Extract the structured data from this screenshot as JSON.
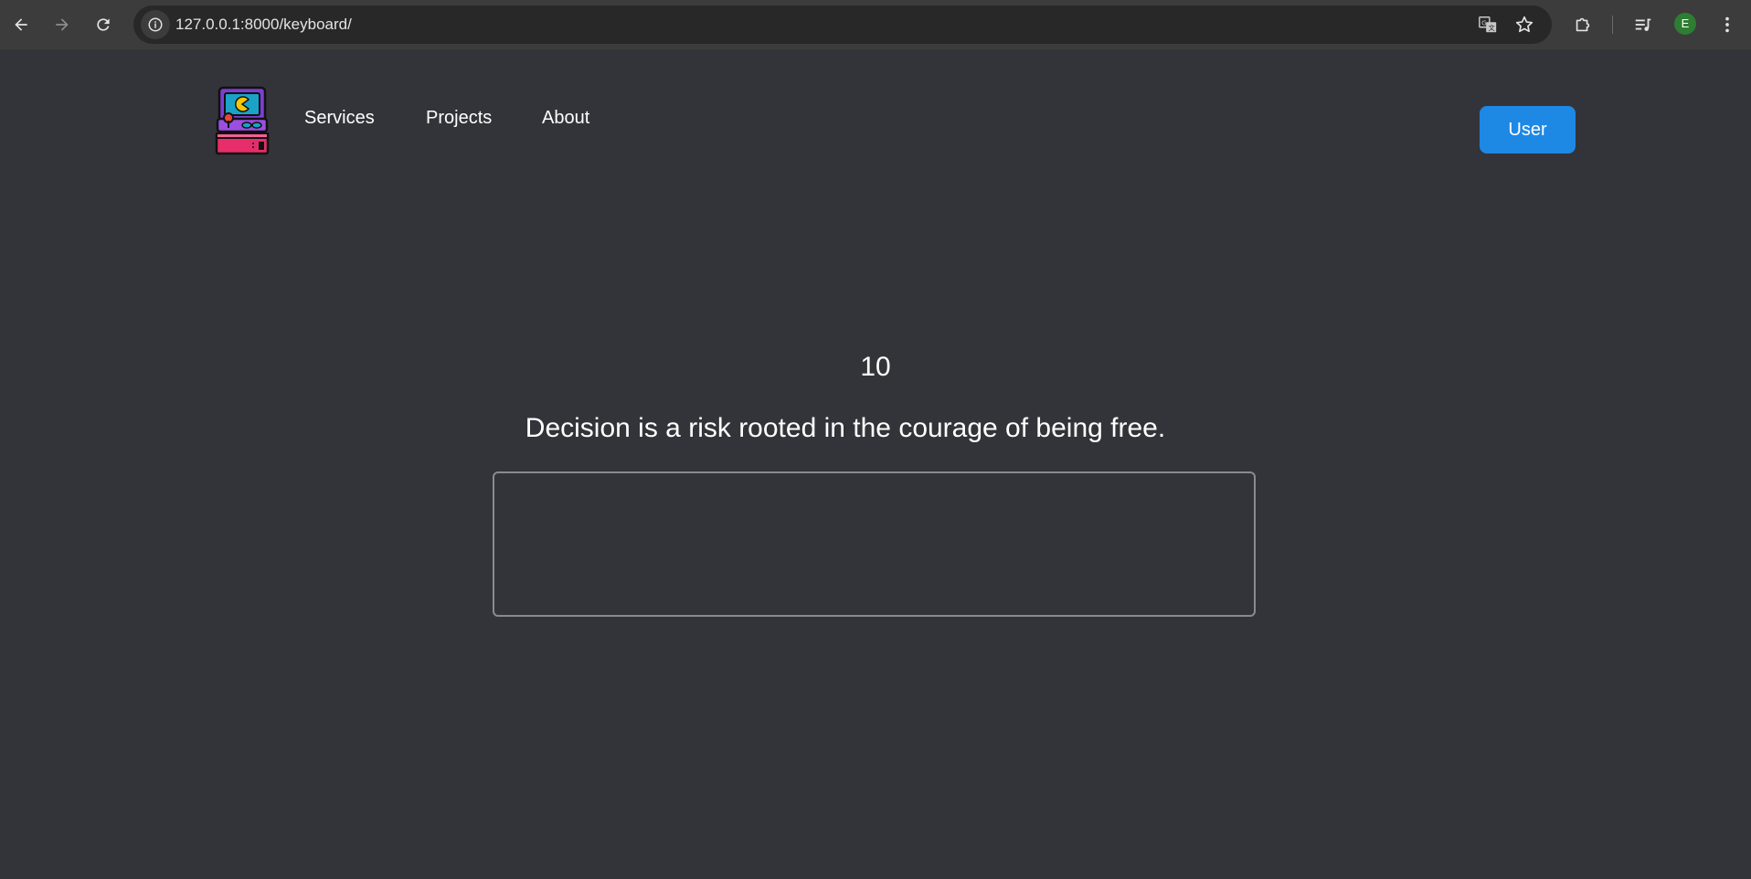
{
  "browser": {
    "url": "127.0.0.1:8000/keyboard/",
    "profile_initial": "E",
    "icons": {
      "back": "arrow-left-icon",
      "forward": "arrow-right-icon",
      "reload": "reload-icon",
      "site_info": "info-icon",
      "translate": "translate-icon",
      "bookmark": "star-icon",
      "extensions": "puzzle-icon",
      "media": "media-queue-icon",
      "menu": "kebab-menu-icon"
    }
  },
  "header": {
    "logo": "arcade-machine-logo",
    "nav": [
      {
        "label": "Services"
      },
      {
        "label": "Projects"
      },
      {
        "label": "About"
      }
    ],
    "user_button": "User"
  },
  "main": {
    "counter": "10",
    "quote": "Decision is a risk rooted in the courage of being free.",
    "input_value": "",
    "input_placeholder": ""
  },
  "colors": {
    "page_background": "#333439",
    "toolbar_background": "#3c3c3c",
    "accent": "#1e88e5",
    "avatar": "#2e7d32"
  }
}
